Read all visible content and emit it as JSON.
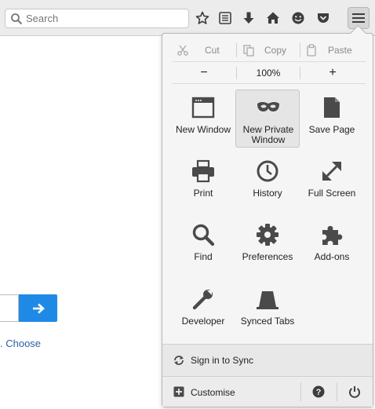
{
  "toolbar": {
    "search_placeholder": "Search",
    "icons": [
      "star-icon",
      "reading-list-icon",
      "download-icon",
      "home-icon",
      "hello-icon",
      "pocket-icon",
      "menu-icon"
    ]
  },
  "page": {
    "choose_text": ". Choose"
  },
  "menu": {
    "edit": {
      "cut": "Cut",
      "copy": "Copy",
      "paste": "Paste"
    },
    "zoom": {
      "out": "−",
      "level": "100%",
      "in": "+"
    },
    "items": [
      {
        "label": "New Window",
        "icon": "window-icon"
      },
      {
        "label": "New Private Window",
        "icon": "private-mask-icon",
        "active": true
      },
      {
        "label": "Save Page",
        "icon": "save-page-icon"
      },
      {
        "label": "Print",
        "icon": "print-icon"
      },
      {
        "label": "History",
        "icon": "history-clock-icon"
      },
      {
        "label": "Full Screen",
        "icon": "fullscreen-icon"
      },
      {
        "label": "Find",
        "icon": "find-icon"
      },
      {
        "label": "Preferences",
        "icon": "gear-icon"
      },
      {
        "label": "Add-ons",
        "icon": "puzzle-icon"
      },
      {
        "label": "Developer",
        "icon": "wrench-icon"
      },
      {
        "label": "Synced Tabs",
        "icon": "synced-tabs-icon"
      }
    ],
    "sync_label": "Sign in to Sync",
    "customise_label": "Customise"
  },
  "colors": {
    "go_button": "#1f8ae6",
    "link": "#2a5fa8",
    "icon": "#4a4a4a"
  }
}
